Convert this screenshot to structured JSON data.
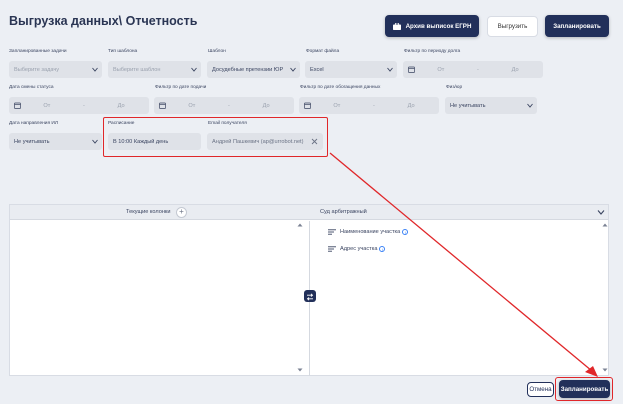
{
  "header": {
    "title": "Выгрузка данных\\ Отчетность",
    "archive_button": "Архив выписок ЕГРН",
    "export_button": "Выгрузить",
    "schedule_button": "Запланировать"
  },
  "filters": {
    "scheduled_tasks": {
      "label": "Запланированные задачи",
      "placeholder": "Выберите задачу"
    },
    "template_type": {
      "label": "Тип шаблона",
      "placeholder": "Выберите шаблон"
    },
    "template": {
      "label": "Шаблон",
      "value": "Досудебные претензии ЮР"
    },
    "file_format": {
      "label": "Формат файла",
      "value": "Excel"
    },
    "debt_period": {
      "label": "Фильтр по периоду долга",
      "from": "От",
      "dash": "-",
      "to": "До"
    },
    "status_change_date": {
      "label": "Дата смены статуса",
      "from": "От",
      "dash": "-",
      "to": "До"
    },
    "filing_date": {
      "label": "Фильтр по дате подачи",
      "from": "От",
      "dash": "-",
      "to": "До"
    },
    "appeal_date": {
      "label": "Фильтр по дате обогащения данных",
      "from": "От",
      "dash": "-",
      "to": "До"
    },
    "person_type": {
      "label": "Физ/юр",
      "value": "Не учитывать"
    },
    "ip_direction_date": {
      "label": "Дата направления ИЛ",
      "value": "Не учитывать"
    },
    "schedule": {
      "label": "Расписание",
      "value": "В 10:00 Каждый день"
    },
    "recipient_email": {
      "label": "Email получателя",
      "value": "Андрей Пашкевич (ap@urrobot.net)"
    }
  },
  "columns_panel": {
    "current_columns_label": "Текущие колонки",
    "plus": "+",
    "source_label": "Суд арбитражный",
    "items": [
      {
        "label": "Наименование участка",
        "info": "i"
      },
      {
        "label": "Адрес участка",
        "info": "i"
      }
    ]
  },
  "footer": {
    "cancel_button": "Отмена",
    "schedule_button": "Запланировать"
  },
  "colors": {
    "primary": "#22305a",
    "highlight": "#e0272a",
    "field_bg": "#dfe2e8",
    "info": "#3b82f6"
  }
}
